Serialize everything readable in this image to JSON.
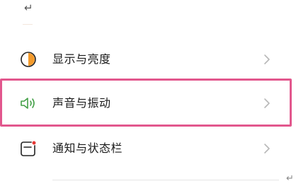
{
  "header": {
    "back_glyph": "↵"
  },
  "settings": {
    "items": [
      {
        "label": "显示与亮度",
        "icon": "brightness-icon"
      },
      {
        "label": "声音与振动",
        "icon": "speaker-icon"
      },
      {
        "label": "通知与状态栏",
        "icon": "notification-icon"
      }
    ]
  },
  "edge_glyph": "↵",
  "colors": {
    "highlight": "#e2578d",
    "brightness_accent": "#f39a2b",
    "speaker_accent": "#43a047",
    "notification_dot": "#e53935"
  }
}
